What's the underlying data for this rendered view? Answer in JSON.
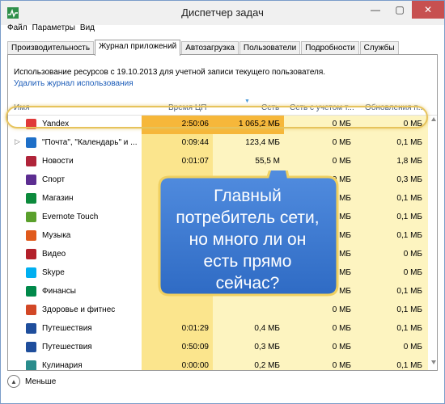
{
  "window": {
    "title": "Диспетчер задач",
    "minimize": "—",
    "maximize": "▢",
    "close": "✕"
  },
  "menu": [
    "Файл",
    "Параметры",
    "Вид"
  ],
  "tabs": [
    "Производительность",
    "Журнал приложений",
    "Автозагрузка",
    "Пользователи",
    "Подробности",
    "Службы"
  ],
  "active_tab": 1,
  "usage_text": "Использование ресурсов с 19.10.2013 для учетной записи текущего пользователя.",
  "delete_link": "Удалить журнал использования",
  "columns": {
    "name": "Имя",
    "cpu": "Время ЦП",
    "net": "Сеть",
    "net_metered": "Сеть с учетом т...",
    "updates": "Обновления п..."
  },
  "rows": [
    {
      "name": "Yandex",
      "cpu": "2:50:06",
      "net": "1 065,2 МБ",
      "net_metered": "0 МБ",
      "updates": "0 МБ",
      "icon": "yandex-icon",
      "color": "#e03a3a",
      "expandable": false
    },
    {
      "name": "\"Почта\", \"Календарь\" и ...",
      "cpu": "0:09:44",
      "net": "123,4 МБ",
      "net_metered": "0 МБ",
      "updates": "0,1 МБ",
      "icon": "mail-icon",
      "color": "#1e6fc8",
      "expandable": true
    },
    {
      "name": "Новости",
      "cpu": "0:01:07",
      "net": "55,5 М",
      "net_metered": "0 МБ",
      "updates": "1,8 МБ",
      "icon": "news-icon",
      "color": "#b0243a",
      "expandable": false
    },
    {
      "name": "Спорт",
      "cpu": "",
      "net": "",
      "net_metered": "0 МБ",
      "updates": "0,3 МБ",
      "icon": "sport-icon",
      "color": "#5c2d91",
      "expandable": false
    },
    {
      "name": "Магазин",
      "cpu": "",
      "net": "",
      "net_metered": "0 МБ",
      "updates": "0,1 МБ",
      "icon": "store-icon",
      "color": "#0c8a3c",
      "expandable": false
    },
    {
      "name": "Evernote Touch",
      "cpu": "",
      "net": "",
      "net_metered": "0 МБ",
      "updates": "0,1 МБ",
      "icon": "evernote-icon",
      "color": "#5aa02c",
      "expandable": false
    },
    {
      "name": "Музыка",
      "cpu": "",
      "net": "",
      "net_metered": "0 МБ",
      "updates": "0,1 МБ",
      "icon": "music-icon",
      "color": "#e05a1c",
      "expandable": false
    },
    {
      "name": "Видео",
      "cpu": "",
      "net": "",
      "net_metered": "0 МБ",
      "updates": "0 МБ",
      "icon": "video-icon",
      "color": "#b3202a",
      "expandable": false
    },
    {
      "name": "Skype",
      "cpu": "",
      "net": "",
      "net_metered": "0 МБ",
      "updates": "0 МБ",
      "icon": "skype-icon",
      "color": "#00aff0",
      "expandable": false
    },
    {
      "name": "Финансы",
      "cpu": "",
      "net": "",
      "net_metered": "0 МБ",
      "updates": "0,1 МБ",
      "icon": "finance-icon",
      "color": "#00894a",
      "expandable": false
    },
    {
      "name": "Здоровье и фитнес",
      "cpu": "",
      "net": "",
      "net_metered": "0 МБ",
      "updates": "0,1 МБ",
      "icon": "health-icon",
      "color": "#d24726",
      "expandable": false
    },
    {
      "name": "Путешествия",
      "cpu": "0:01:29",
      "net": "0,4 МБ",
      "net_metered": "0 МБ",
      "updates": "0,1 МБ",
      "icon": "travel-icon",
      "color": "#1f4e9c",
      "expandable": false
    },
    {
      "name": "Путешествия",
      "cpu": "0:50:09",
      "net": "0,3 МБ",
      "net_metered": "0 МБ",
      "updates": "0 МБ",
      "icon": "travel-icon",
      "color": "#1f4e9c",
      "expandable": false
    },
    {
      "name": "Кулинария",
      "cpu": "0:00:00",
      "net": "0,2 МБ",
      "net_metered": "0 МБ",
      "updates": "0,1 МБ",
      "icon": "food-icon",
      "color": "#2a8c8c",
      "expandable": false
    },
    {
      "name": "",
      "cpu": "0:00:00",
      "net": "0,1 МБ",
      "net_metered": "0 МБ",
      "updates": "0 МБ",
      "icon": "app-icon",
      "color": "#1e6fc8",
      "expandable": false
    }
  ],
  "footer": {
    "fewer": "Меньше"
  },
  "callout": {
    "text": "Главный потребитель сети, но много ли он есть прямо сейчас?"
  },
  "colors": {
    "accent_link": "#1a5bb8",
    "cpu_highlight": "#f6b73a",
    "col_yellow": "#fdf4c0",
    "col_yellow_strong": "#fbe58d",
    "callout_blue": "#3d7bd6",
    "ring": "#e6c35c"
  }
}
